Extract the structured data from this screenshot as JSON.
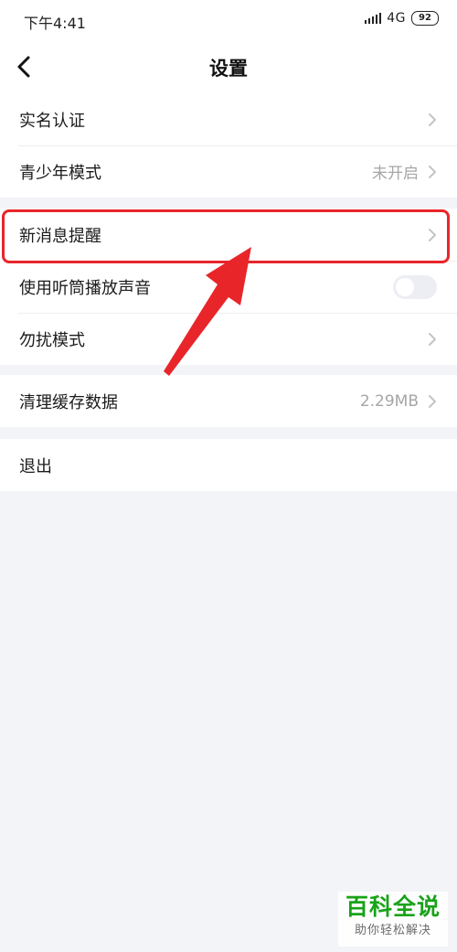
{
  "status_bar": {
    "time": "下午4:41",
    "network": "4G",
    "battery": "92"
  },
  "nav": {
    "title": "设置"
  },
  "groups": [
    {
      "items": [
        {
          "label": "实名认证",
          "value": ""
        },
        {
          "label": "青少年模式",
          "value": "未开启"
        }
      ]
    },
    {
      "items": [
        {
          "label": "新消息提醒",
          "value": ""
        },
        {
          "label": "使用听筒播放声音",
          "toggle": false
        },
        {
          "label": "勿扰模式",
          "value": ""
        }
      ]
    },
    {
      "items": [
        {
          "label": "清理缓存数据",
          "value": "2.29MB"
        }
      ]
    },
    {
      "items": [
        {
          "label": "退出"
        }
      ]
    }
  ],
  "annotation": {
    "color": "#e8262a"
  },
  "watermark": {
    "title": "百科全说",
    "subtitle": "助你轻松解决",
    "color": "#19a319"
  }
}
